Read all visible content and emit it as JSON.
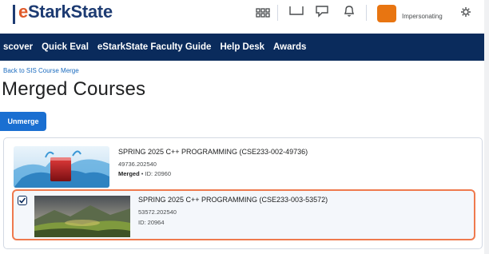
{
  "brand": {
    "logo_text_accent": "e",
    "logo_text_rest": "StarkState"
  },
  "header": {
    "icons": [
      "apps-grid-icon",
      "message-icon",
      "chat-icon",
      "bell-icon",
      "settings-gear-icon"
    ],
    "user_status": "Impersonating"
  },
  "nav": {
    "items": [
      "scover",
      "Quick Eval",
      "eStarkState Faculty Guide",
      "Help Desk",
      "Awards"
    ]
  },
  "breadcrumb": {
    "back_label": "Back to SIS Course Merge"
  },
  "page": {
    "title": "Merged Courses"
  },
  "toolbar": {
    "unmerge_label": "Unmerge"
  },
  "courses": [
    {
      "title": "SPRING 2025 C++ PROGRAMMING (CSE233-002-49736)",
      "code": "49736.202540",
      "status": "Merged",
      "id_label": "ID: 20960",
      "checked": false,
      "image": "water-glass-splash"
    },
    {
      "title": "SPRING 2025 C++ PROGRAMMING (CSE233-003-53572)",
      "code": "53572.202540",
      "id_label": "ID: 20964",
      "checked": true,
      "image": "mountain-valley-landscape"
    }
  ],
  "colors": {
    "nav_bg": "#0a2b5c",
    "primary_button": "#1a6fd1",
    "link": "#1a6bbf",
    "selection_border": "#ef7a4e",
    "user_chip": "#e87511"
  }
}
